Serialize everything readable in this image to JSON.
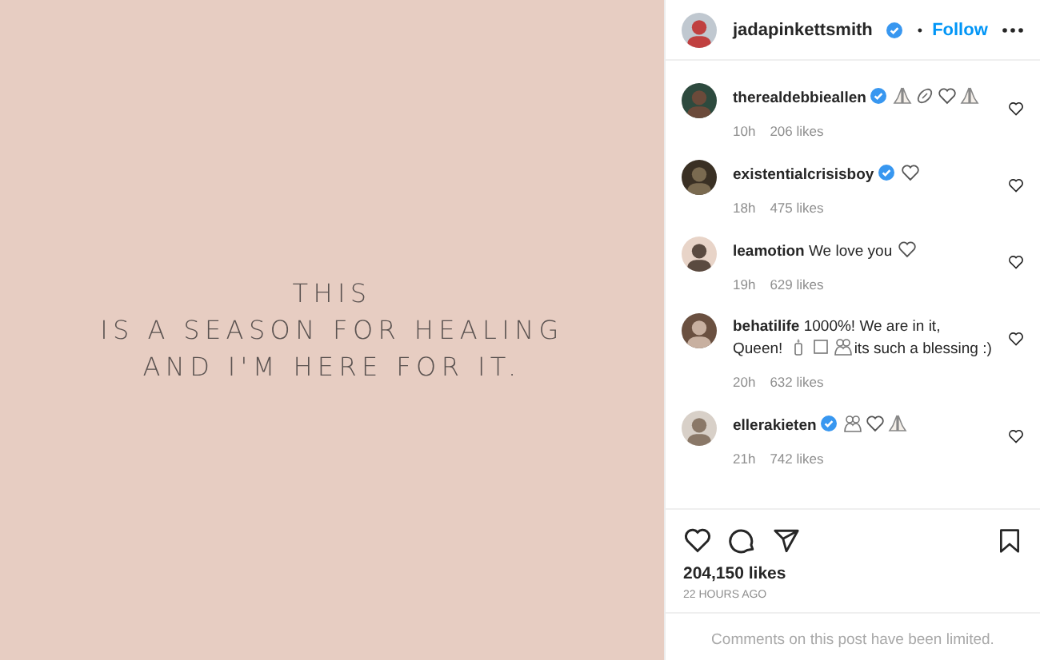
{
  "post_image": {
    "lines": [
      "THIS",
      "IS A SEASON FOR HEALING",
      "AND I'M HERE FOR IT."
    ]
  },
  "header": {
    "username": "jadapinkettsmith",
    "verified": true,
    "separator": "•",
    "follow": "Follow"
  },
  "comments": [
    {
      "username": "therealdebbieallen",
      "verified": true,
      "parts": [
        {
          "kind": "pray"
        },
        {
          "kind": "football"
        },
        {
          "kind": "heart"
        },
        {
          "kind": "pray"
        }
      ],
      "time": "10h",
      "likes": "206 likes"
    },
    {
      "username": "existentialcrisisboy",
      "verified": true,
      "parts": [
        {
          "kind": "heart"
        }
      ],
      "time": "18h",
      "likes": "475 likes"
    },
    {
      "username": "leamotion",
      "verified": false,
      "parts": [
        {
          "kind": "text",
          "text": "We love you"
        },
        {
          "kind": "heart"
        }
      ],
      "time": "19h",
      "likes": "629 likes"
    },
    {
      "username": "behatilife",
      "verified": false,
      "parts": [
        {
          "kind": "text",
          "text": "1000%! We are in it, Queen!"
        },
        {
          "kind": "candle"
        },
        {
          "kind": "box"
        },
        {
          "kind": "hug"
        },
        {
          "kind": "text",
          "text": "its such a blessing :)"
        }
      ],
      "time": "20h",
      "likes": "632 likes"
    },
    {
      "username": "ellerakieten",
      "verified": true,
      "parts": [
        {
          "kind": "hug"
        },
        {
          "kind": "heart"
        },
        {
          "kind": "pray"
        }
      ],
      "time": "21h",
      "likes": "742 likes"
    }
  ],
  "likes": "204,150 likes",
  "posted": "22 HOURS AGO",
  "limited_notice": "Comments on this post have been limited."
}
